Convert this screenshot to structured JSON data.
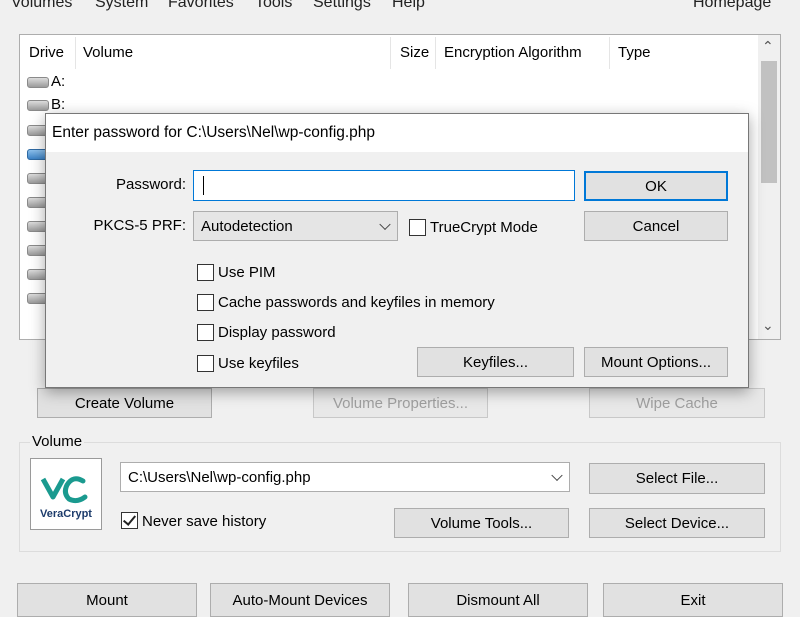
{
  "menu": {
    "items": [
      "Volumes",
      "System",
      "Favorites",
      "Tools",
      "Settings",
      "Help"
    ],
    "homepage": "Homepage"
  },
  "drive_list": {
    "headers": [
      "Drive",
      "Volume",
      "Size",
      "Encryption Algorithm",
      "Type"
    ],
    "drives": [
      "A:",
      "B:",
      "",
      "",
      "",
      "",
      "",
      "",
      "",
      ""
    ]
  },
  "buttons": {
    "create_volume": "Create Volume",
    "volume_properties": "Volume Properties...",
    "wipe_cache": "Wipe Cache",
    "select_file": "Select File...",
    "volume_tools": "Volume Tools...",
    "select_device": "Select Device...",
    "mount": "Mount",
    "auto_mount": "Auto-Mount Devices",
    "dismount_all": "Dismount All",
    "exit": "Exit"
  },
  "volume": {
    "group_label": "Volume",
    "path": "C:\\Users\\Nel\\wp-config.php",
    "never_save_history": "Never save history",
    "never_save_history_checked": true,
    "logo_text": "VeraCrypt",
    "logo_mark": "VC"
  },
  "password_dialog": {
    "title": "Enter password for C:\\Users\\Nel\\wp-config.php",
    "password_label": "Password:",
    "password_value": "",
    "prf_label": "PKCS-5 PRF:",
    "prf_value": "Autodetection",
    "truecrypt_mode": "TrueCrypt Mode",
    "use_pim": "Use PIM",
    "cache_passwords": "Cache passwords and keyfiles in memory",
    "display_password": "Display password",
    "use_keyfiles": "Use keyfiles",
    "ok": "OK",
    "cancel": "Cancel",
    "keyfiles": "Keyfiles...",
    "mount_options": "Mount Options..."
  },
  "colors": {
    "accent": "#0078d7",
    "selected_drive": "#3d83c6",
    "logo_teal": "#1a9a8f",
    "logo_navy": "#1c3b6b"
  }
}
